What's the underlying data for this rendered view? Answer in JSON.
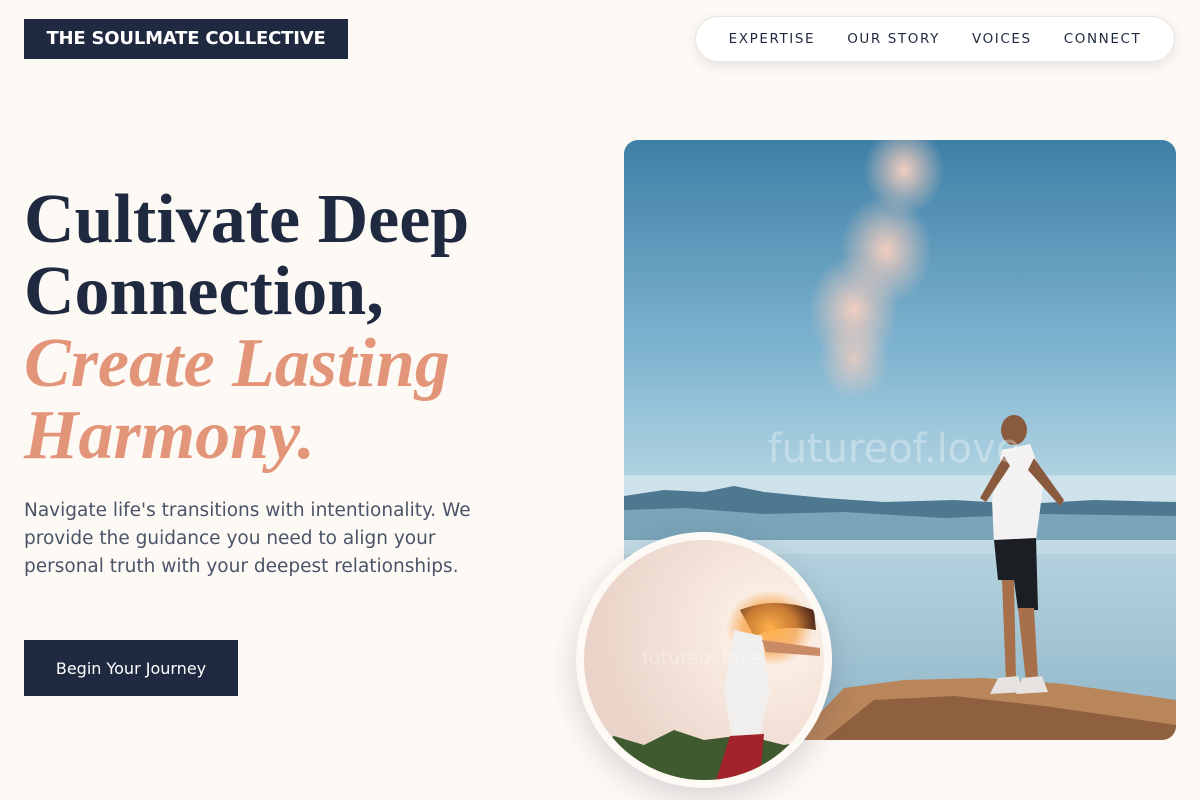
{
  "brand": {
    "name": "THE SOULMATE COLLECTIVE"
  },
  "nav": {
    "items": [
      {
        "label": "EXPERTISE"
      },
      {
        "label": "OUR STORY"
      },
      {
        "label": "VOICES"
      },
      {
        "label": "CONNECT"
      }
    ]
  },
  "hero": {
    "headline_line1": "Cultivate Deep",
    "headline_line2": "Connection,",
    "accent_line1": "Create Lasting",
    "accent_line2": "Harmony.",
    "description": "Navigate life's transitions with intentionality. We provide the guidance you need to align your personal truth with your deepest relationships.",
    "cta_label": "Begin Your Journey"
  },
  "images": {
    "main_watermark": "futureof.love",
    "inset_watermark": "futureof.love"
  },
  "colors": {
    "background": "#fdf9f5",
    "navy": "#1f2a40",
    "accent": "#e3957a",
    "body_text": "#4a5468"
  }
}
